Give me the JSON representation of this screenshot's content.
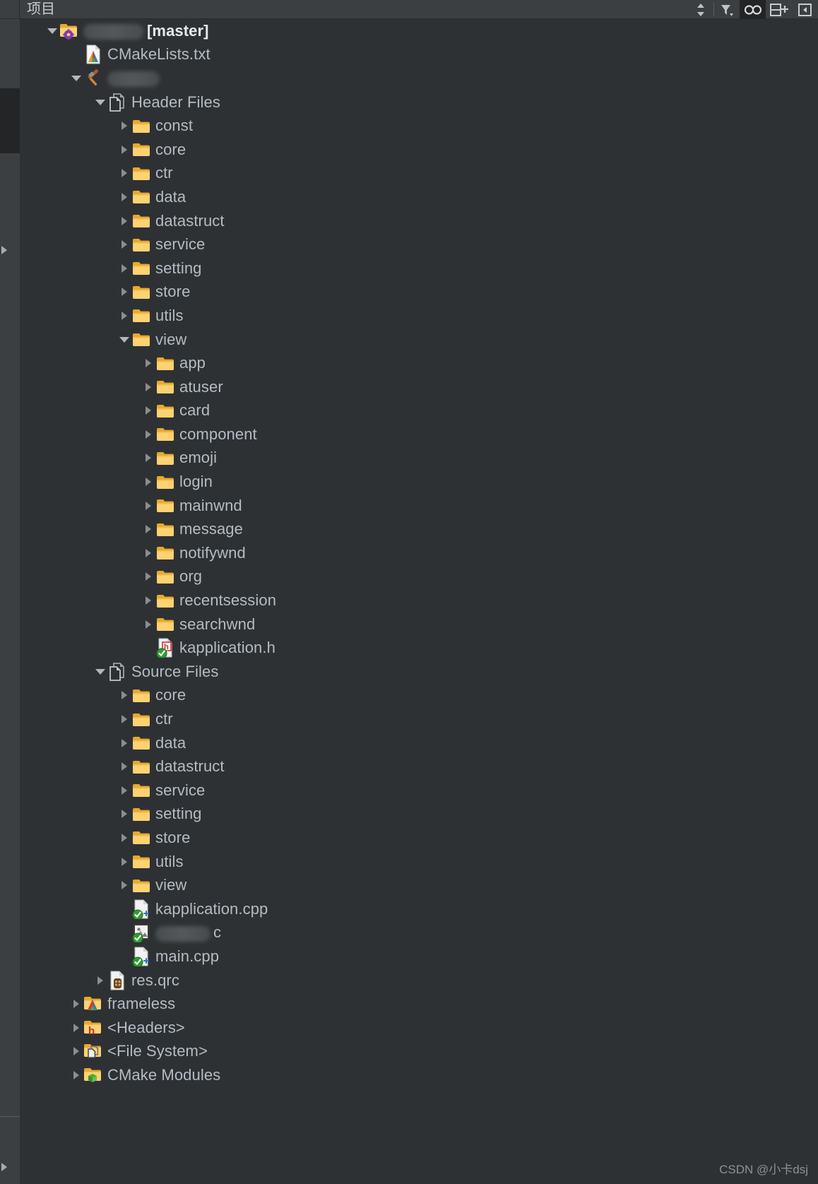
{
  "panel": {
    "title": "项目",
    "watermark": "CSDN @小卡dsj"
  },
  "toolbar": {
    "items": [
      {
        "name": "sort-icon",
        "label": "排序"
      },
      {
        "name": "filter-icon",
        "label": "筛选"
      },
      {
        "name": "link-icon",
        "label": "与编辑器同步",
        "active": true
      },
      {
        "name": "split-add-icon",
        "label": "新建拆分"
      },
      {
        "name": "collapse-icon",
        "label": "折叠"
      }
    ]
  },
  "tree": {
    "rows": [
      {
        "indent": 0,
        "twisty": "down",
        "icon": "folder-project-icon",
        "redact_width": 86,
        "label": "[master]",
        "bold": true
      },
      {
        "indent": 1,
        "twisty": "none",
        "icon": "cmake-file-icon",
        "label": "CMakeLists.txt"
      },
      {
        "indent": 1,
        "twisty": "down",
        "icon": "hammer-icon",
        "redact_width": 74,
        "label": ""
      },
      {
        "indent": 2,
        "twisty": "down",
        "icon": "documents-icon",
        "label": "Header Files"
      },
      {
        "indent": 3,
        "twisty": "right",
        "icon": "folder-icon",
        "label": "const"
      },
      {
        "indent": 3,
        "twisty": "right",
        "icon": "folder-icon",
        "label": "core"
      },
      {
        "indent": 3,
        "twisty": "right",
        "icon": "folder-icon",
        "label": "ctr"
      },
      {
        "indent": 3,
        "twisty": "right",
        "icon": "folder-icon",
        "label": "data"
      },
      {
        "indent": 3,
        "twisty": "right",
        "icon": "folder-icon",
        "label": "datastruct"
      },
      {
        "indent": 3,
        "twisty": "right",
        "icon": "folder-icon",
        "label": "service"
      },
      {
        "indent": 3,
        "twisty": "right",
        "icon": "folder-icon",
        "label": "setting"
      },
      {
        "indent": 3,
        "twisty": "right",
        "icon": "folder-icon",
        "label": "store"
      },
      {
        "indent": 3,
        "twisty": "right",
        "icon": "folder-icon",
        "label": "utils"
      },
      {
        "indent": 3,
        "twisty": "down",
        "icon": "folder-icon",
        "label": "view"
      },
      {
        "indent": 4,
        "twisty": "right",
        "icon": "folder-icon",
        "label": "app"
      },
      {
        "indent": 4,
        "twisty": "right",
        "icon": "folder-icon",
        "label": "atuser"
      },
      {
        "indent": 4,
        "twisty": "right",
        "icon": "folder-icon",
        "label": "card"
      },
      {
        "indent": 4,
        "twisty": "right",
        "icon": "folder-icon",
        "label": "component"
      },
      {
        "indent": 4,
        "twisty": "right",
        "icon": "folder-icon",
        "label": "emoji"
      },
      {
        "indent": 4,
        "twisty": "right",
        "icon": "folder-icon",
        "label": "login"
      },
      {
        "indent": 4,
        "twisty": "right",
        "icon": "folder-icon",
        "label": "mainwnd"
      },
      {
        "indent": 4,
        "twisty": "right",
        "icon": "folder-icon",
        "label": "message"
      },
      {
        "indent": 4,
        "twisty": "right",
        "icon": "folder-icon",
        "label": "notifywnd"
      },
      {
        "indent": 4,
        "twisty": "right",
        "icon": "folder-icon",
        "label": "org"
      },
      {
        "indent": 4,
        "twisty": "right",
        "icon": "folder-icon",
        "label": "recentsession"
      },
      {
        "indent": 4,
        "twisty": "right",
        "icon": "folder-icon",
        "label": "searchwnd"
      },
      {
        "indent": 4,
        "twisty": "none",
        "icon": "header-file-vcs-icon",
        "label": "kapplication.h"
      },
      {
        "indent": 2,
        "twisty": "down",
        "icon": "documents-icon",
        "label": "Source Files"
      },
      {
        "indent": 3,
        "twisty": "right",
        "icon": "folder-icon",
        "label": "core"
      },
      {
        "indent": 3,
        "twisty": "right",
        "icon": "folder-icon",
        "label": "ctr"
      },
      {
        "indent": 3,
        "twisty": "right",
        "icon": "folder-icon",
        "label": "data"
      },
      {
        "indent": 3,
        "twisty": "right",
        "icon": "folder-icon",
        "label": "datastruct"
      },
      {
        "indent": 3,
        "twisty": "right",
        "icon": "folder-icon",
        "label": "service"
      },
      {
        "indent": 3,
        "twisty": "right",
        "icon": "folder-icon",
        "label": "setting"
      },
      {
        "indent": 3,
        "twisty": "right",
        "icon": "folder-icon",
        "label": "store"
      },
      {
        "indent": 3,
        "twisty": "right",
        "icon": "folder-icon",
        "label": "utils"
      },
      {
        "indent": 3,
        "twisty": "right",
        "icon": "folder-icon",
        "label": "view"
      },
      {
        "indent": 3,
        "twisty": "none",
        "icon": "cpp-file-vcs-icon",
        "label": "kapplication.cpp"
      },
      {
        "indent": 3,
        "twisty": "none",
        "icon": "image-file-vcs-icon",
        "redact_width": 78,
        "label": "c"
      },
      {
        "indent": 3,
        "twisty": "none",
        "icon": "cpp-file-vcs-icon",
        "label": "main.cpp"
      },
      {
        "indent": 2,
        "twisty": "right",
        "icon": "qrc-file-icon",
        "label": "res.qrc"
      },
      {
        "indent": 1,
        "twisty": "right",
        "icon": "folder-cmake-icon",
        "label": "frameless"
      },
      {
        "indent": 1,
        "twisty": "right",
        "icon": "folder-headers-icon",
        "label": "<Headers>"
      },
      {
        "indent": 1,
        "twisty": "right",
        "icon": "folder-filesys-icon",
        "label": "<File System>"
      },
      {
        "indent": 1,
        "twisty": "right",
        "icon": "folder-modules-icon",
        "label": "CMake Modules"
      }
    ]
  },
  "colors": {
    "background": "#2e3133",
    "header": "#3c3f41",
    "gutter": "#3c3f41",
    "text": "#b3bcc4",
    "text_bold": "#e6e9ec",
    "folder": "#f5c04a",
    "vcs_added": "#35a735",
    "accent_active": "#222426"
  }
}
